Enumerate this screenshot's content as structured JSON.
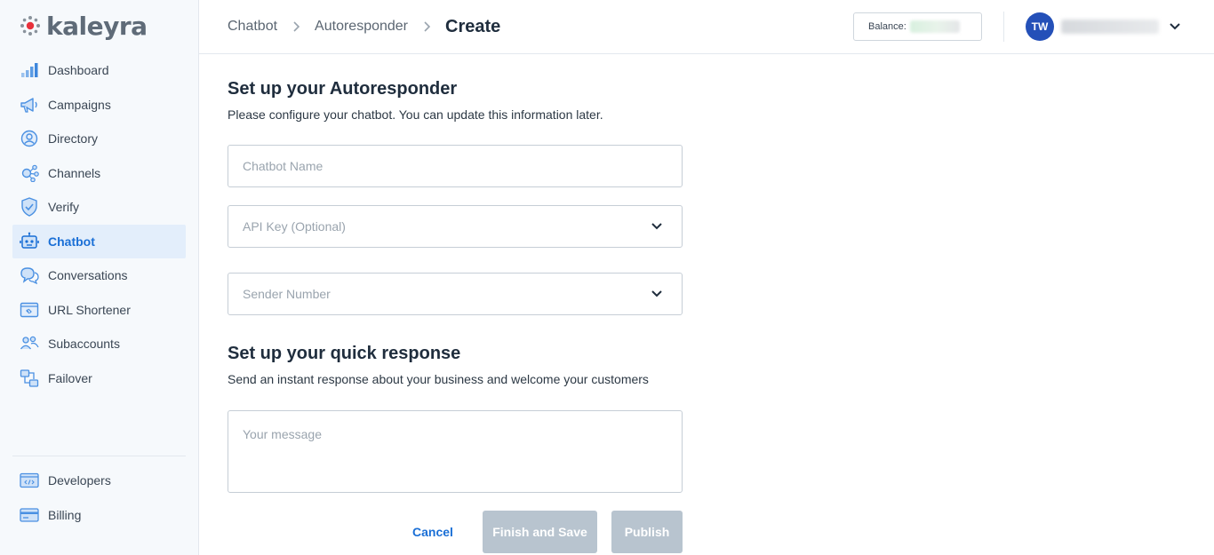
{
  "brand": {
    "name": "kaleyra"
  },
  "sidebar": {
    "items": [
      {
        "label": "Dashboard",
        "icon": "bar-chart-icon",
        "active": false
      },
      {
        "label": "Campaigns",
        "icon": "megaphone-icon",
        "active": false
      },
      {
        "label": "Directory",
        "icon": "user-circle-icon",
        "active": false
      },
      {
        "label": "Channels",
        "icon": "channels-icon",
        "active": false
      },
      {
        "label": "Verify",
        "icon": "shield-icon",
        "active": false
      },
      {
        "label": "Chatbot",
        "icon": "robot-icon",
        "active": true
      },
      {
        "label": "Conversations",
        "icon": "chat-bubbles-icon",
        "active": false
      },
      {
        "label": "URL Shortener",
        "icon": "link-icon",
        "active": false
      },
      {
        "label": "Subaccounts",
        "icon": "users-icon",
        "active": false
      },
      {
        "label": "Failover",
        "icon": "failover-icon",
        "active": false
      }
    ],
    "bottom_items": [
      {
        "label": "Developers",
        "icon": "code-icon"
      },
      {
        "label": "Billing",
        "icon": "credit-card-icon"
      }
    ]
  },
  "header": {
    "breadcrumb": [
      "Chatbot",
      "Autoresponder"
    ],
    "current": "Create",
    "balance_label": "Balance:",
    "user_initials": "TW"
  },
  "main": {
    "setup_title": "Set up your Autoresponder",
    "setup_subtitle": "Please configure your chatbot. You can update this information later.",
    "chatbot_name_placeholder": "Chatbot Name",
    "api_key_placeholder": "API Key (Optional)",
    "sender_number_placeholder": "Sender Number",
    "quick_title": "Set up your quick response",
    "quick_subtitle": "Send an instant response about your business and welcome your customers",
    "message_placeholder": "Your message"
  },
  "actions": {
    "cancel": "Cancel",
    "finish_save": "Finish and Save",
    "publish": "Publish"
  },
  "colors": {
    "accent": "#1a6fd6",
    "active_bg": "#e3eefb",
    "icon_blue": "#4a90e2",
    "disabled_button": "#b8c4cf",
    "avatar": "#2450b8"
  }
}
